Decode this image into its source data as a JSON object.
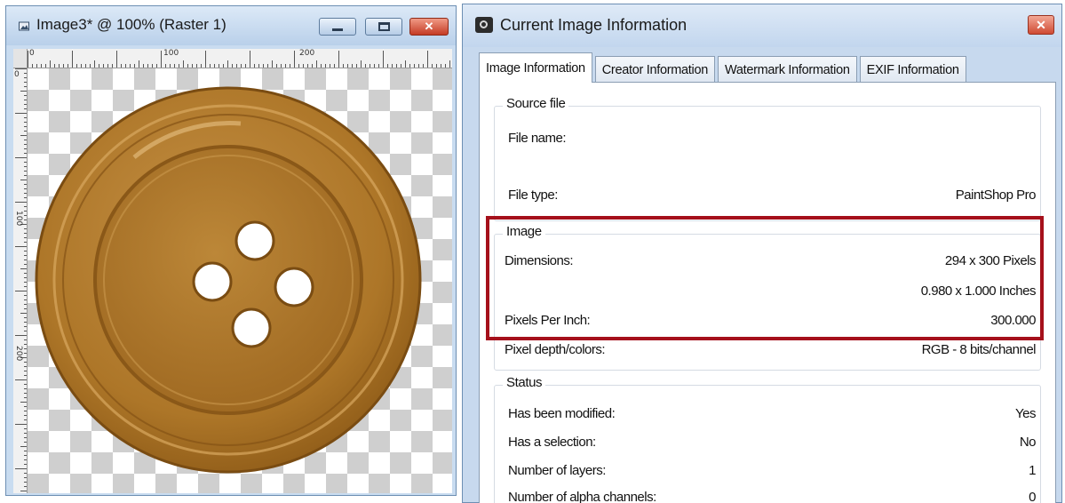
{
  "image_window": {
    "title": "Image3* @ 100% (Raster 1)",
    "ruler_marks": [
      "0",
      "100",
      "200"
    ],
    "ruler_side_marks": [
      "0",
      "100",
      "200"
    ]
  },
  "dialog": {
    "title": "Current Image Information",
    "close_label": "✕",
    "tabs": [
      {
        "label": "Image Information"
      },
      {
        "label": "Creator Information"
      },
      {
        "label": "Watermark Information"
      },
      {
        "label": "EXIF Information"
      }
    ],
    "source_file": {
      "legend": "Source file",
      "file_name_label": "File name:",
      "file_name_value": "",
      "file_type_label": "File type:",
      "file_type_value": "PaintShop Pro"
    },
    "image": {
      "legend": "Image",
      "dimensions_label": "Dimensions:",
      "dimensions_pixels": "294 x 300 Pixels",
      "dimensions_inches": "0.980 x 1.000 Inches",
      "ppi_label": "Pixels Per Inch:",
      "ppi_value": "300.000",
      "depth_label": "Pixel depth/colors:",
      "depth_value": "RGB - 8 bits/channel"
    },
    "status": {
      "legend": "Status",
      "modified_label": "Has been modified:",
      "modified_value": "Yes",
      "selection_label": "Has a selection:",
      "selection_value": "No",
      "layers_label": "Number of layers:",
      "layers_value": "1",
      "alpha_label": "Number of alpha channels:",
      "alpha_value": "0"
    }
  },
  "colors": {
    "highlight": "#a5101b",
    "button_fill": "#b07a2c",
    "titlebar": "#c9dcf0"
  }
}
